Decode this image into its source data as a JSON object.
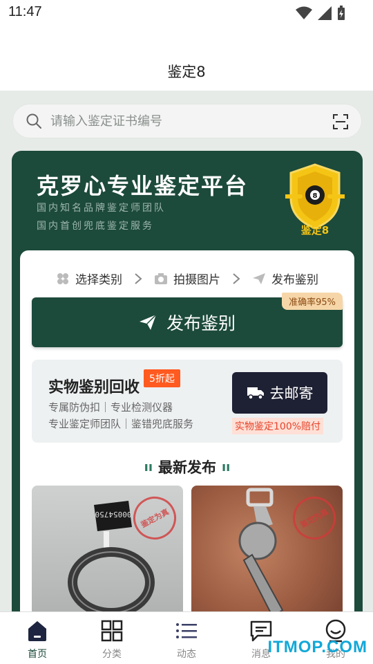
{
  "status": {
    "time": "11:47"
  },
  "app": {
    "title": "鉴定8"
  },
  "search": {
    "placeholder": "请输入鉴定证书编号"
  },
  "hero": {
    "title": "克罗心专业鉴定平台",
    "subtitle_1": "国内知名品牌鉴定师团队",
    "subtitle_2": "国内首创兜底鉴定服务",
    "badge_text": "鉴定8"
  },
  "steps": [
    {
      "label": "选择类别",
      "icon": "category-icon"
    },
    {
      "label": "拍摄图片",
      "icon": "camera-icon"
    },
    {
      "label": "发布鉴别",
      "icon": "send-icon"
    }
  ],
  "publish": {
    "label": "发布鉴别",
    "accuracy_tag": "准确率95%"
  },
  "recycle": {
    "title": "实物鉴别回收",
    "discount_tag": "5折起",
    "line_1": "专属防伪扣｜专业检测仪器",
    "line_2": "专业鉴定师团队｜鉴错兜底服务",
    "mail_button": "去邮寄",
    "guarantee": "实物鉴定100%赔付"
  },
  "latest": {
    "title": "最新发布",
    "items": [
      {
        "stamp": "鉴定为真",
        "tag_number": "00054750"
      },
      {
        "stamp": "鉴定为真"
      }
    ]
  },
  "tabs": [
    {
      "label": "首页",
      "icon": "home-icon",
      "active": true
    },
    {
      "label": "分类",
      "icon": "grid-icon",
      "active": false
    },
    {
      "label": "动态",
      "icon": "list-icon",
      "active": false
    },
    {
      "label": "消息",
      "icon": "message-icon",
      "active": false
    },
    {
      "label": "我的",
      "icon": "profile-icon",
      "active": false
    }
  ],
  "watermark": "ITMOP.COM",
  "colors": {
    "brand": "#1c4a3b",
    "accent": "#ff5a1f",
    "dark_button": "#1e2033",
    "gold": "#f5c516"
  }
}
